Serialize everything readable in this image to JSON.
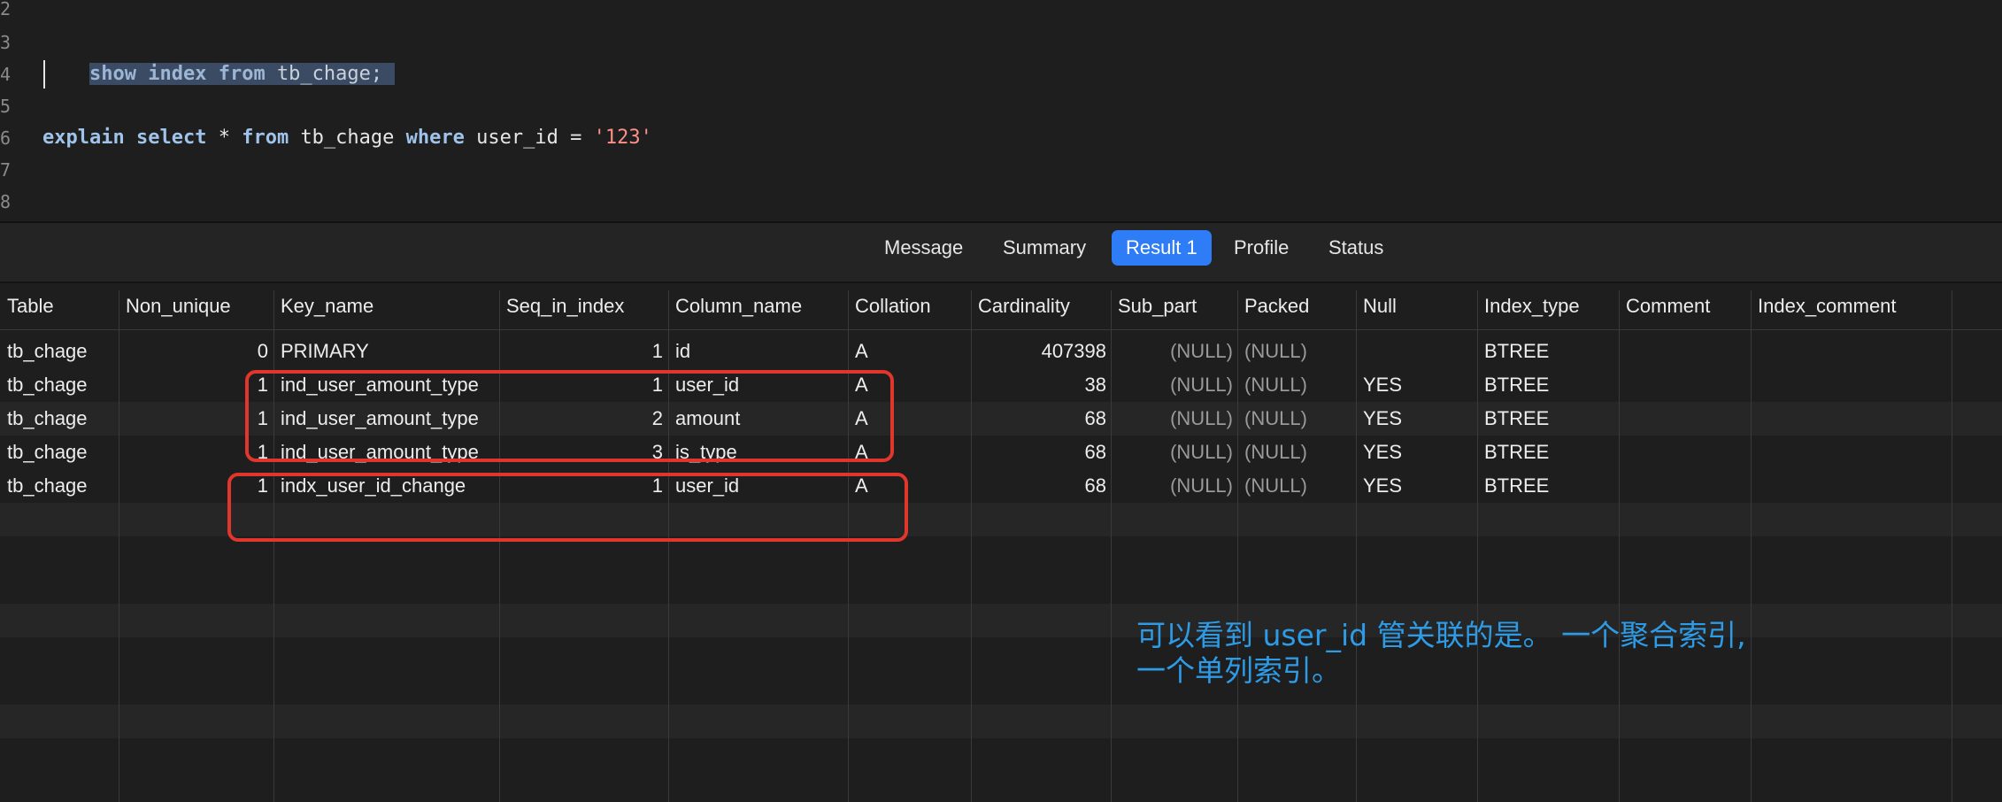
{
  "editor": {
    "line_numbers": [
      "2",
      "3",
      "4",
      "5",
      "6",
      "7",
      "8"
    ],
    "line3": {
      "kw1": "show",
      "kw2": "index",
      "kw3": "from",
      "table": "tb_chage;"
    },
    "line6": {
      "kw1": "explain",
      "kw2": "select",
      "star": "*",
      "kw3": "from",
      "table": "tb_chage",
      "kw4": "where",
      "col": "user_id",
      "op": "=",
      "value": "'123'"
    }
  },
  "tabs": [
    {
      "label": "Message",
      "active": false
    },
    {
      "label": "Summary",
      "active": false
    },
    {
      "label": "Result 1",
      "active": true
    },
    {
      "label": "Profile",
      "active": false
    },
    {
      "label": "Status",
      "active": false
    }
  ],
  "result": {
    "columns": [
      "Table",
      "Non_unique",
      "Key_name",
      "Seq_in_index",
      "Column_name",
      "Collation",
      "Cardinality",
      "Sub_part",
      "Packed",
      "Null",
      "Index_type",
      "Comment",
      "Index_comment"
    ],
    "rows": [
      [
        "tb_chage",
        "0",
        "PRIMARY",
        "1",
        "id",
        "A",
        "407398",
        "(NULL)",
        "(NULL)",
        "",
        "BTREE",
        "",
        ""
      ],
      [
        "tb_chage",
        "1",
        "ind_user_amount_type",
        "1",
        "user_id",
        "A",
        "38",
        "(NULL)",
        "(NULL)",
        "YES",
        "BTREE",
        "",
        ""
      ],
      [
        "tb_chage",
        "1",
        "ind_user_amount_type",
        "2",
        "amount",
        "A",
        "68",
        "(NULL)",
        "(NULL)",
        "YES",
        "BTREE",
        "",
        ""
      ],
      [
        "tb_chage",
        "1",
        "ind_user_amount_type",
        "3",
        "is_type",
        "A",
        "68",
        "(NULL)",
        "(NULL)",
        "YES",
        "BTREE",
        "",
        ""
      ],
      [
        "tb_chage",
        "1",
        "indx_user_id_change",
        "1",
        "user_id",
        "A",
        "68",
        "(NULL)",
        "(NULL)",
        "YES",
        "BTREE",
        "",
        ""
      ]
    ]
  },
  "annotation": {
    "line1": "可以看到 user_id 管关联的是。 一个聚合索引,",
    "line2": "一个单列索引。"
  },
  "colors": {
    "highlight_box": "#e0362b",
    "active_tab": "#2e7cf6",
    "annotation_text": "#2e9be6",
    "selection": "#3b4b63"
  }
}
